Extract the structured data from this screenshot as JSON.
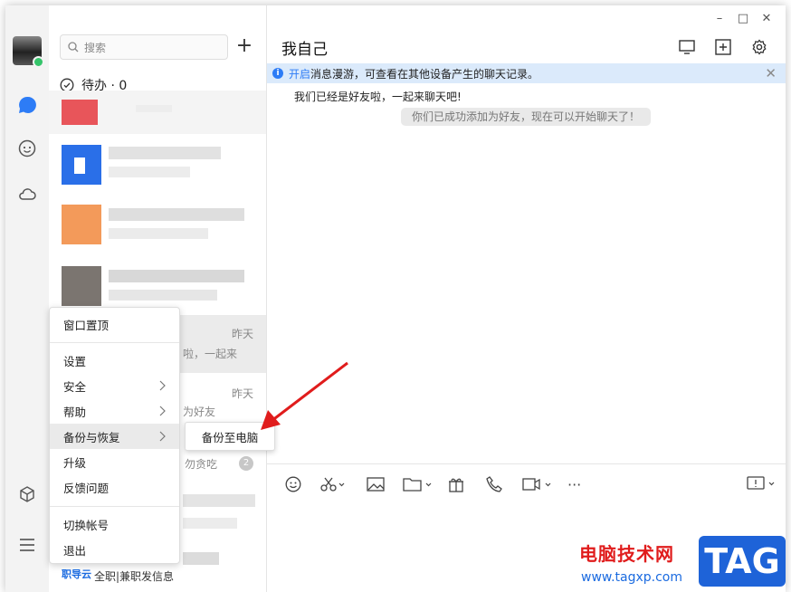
{
  "sidebar": {
    "search_placeholder": "搜索",
    "add_label": "+",
    "todo_label": "待办 · 0"
  },
  "conversations": [
    {
      "time": "",
      "preview": ""
    },
    {
      "time": "",
      "preview": ""
    },
    {
      "time": "",
      "preview": ""
    },
    {
      "time": "",
      "preview": ""
    },
    {
      "time": "昨天",
      "preview": "啦，一起来"
    },
    {
      "time": "昨天",
      "preview": "为好友"
    },
    {
      "time": "",
      "preview": "勿贪吃",
      "badge": "2"
    }
  ],
  "chat": {
    "title": "我自己",
    "notice_link": "开启",
    "notice_text": "消息漫游，可查看在其他设备产生的聊天记录。",
    "message": "我们已经是好友啦，一起来聊天吧!",
    "system_tip": "你们已成功添加为好友，现在可以开始聊天了！"
  },
  "window_controls": {
    "minimize": "–",
    "maximize": "□",
    "close": "✕"
  },
  "menu": {
    "items": [
      "窗口置顶",
      "设置",
      "安全",
      "帮助",
      "备份与恢复",
      "升级",
      "反馈问题",
      "切换帐号",
      "退出"
    ]
  },
  "submenu": {
    "backup_to_pc": "备份至电脑"
  },
  "bottom": {
    "logo": "职导云",
    "text": "全职|兼职发信息"
  },
  "watermark": {
    "text": "电脑技术网",
    "url": "www.tagxp.com",
    "tag": "TAG"
  },
  "colors": {
    "accent": "#2d7cf6",
    "arrow": "#e01c1c",
    "online": "#35c46a"
  }
}
